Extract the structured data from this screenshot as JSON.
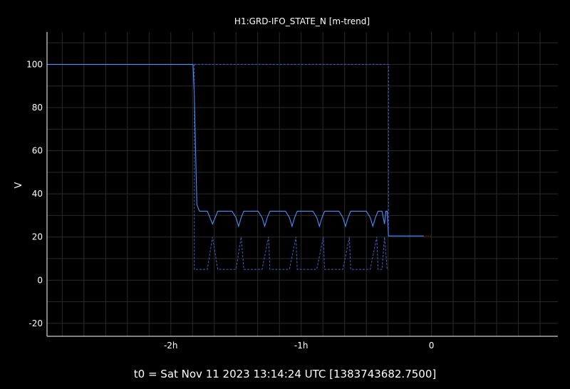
{
  "chart_data": {
    "type": "line",
    "title": "H1:GRD-IFO_STATE_N [m-trend]",
    "ylabel": "V",
    "xlabel": "",
    "footer": "t0 = Sat Nov 11 2023 13:14:24 UTC [1383743682.7500]",
    "x_unit": "hours relative to t0",
    "xlim": [
      -2.95,
      0.97
    ],
    "ylim": [
      -26,
      115
    ],
    "x_ticks": [
      {
        "value": -2,
        "label": "-2h"
      },
      {
        "value": -1,
        "label": "-1h"
      },
      {
        "value": 0,
        "label": "0"
      }
    ],
    "y_ticks": [
      -20,
      0,
      20,
      40,
      60,
      80,
      100
    ],
    "grid": true,
    "colors": {
      "background": "#000000",
      "grid": "#2a2a2a",
      "axis": "#ffffff",
      "mean": "#4a90ff",
      "range": "#3b63c9",
      "trailing": "#c0392b"
    },
    "series": [
      {
        "style": "solid",
        "x": [
          -2.95,
          -1.83,
          -1.82,
          -1.8,
          -1.78,
          -1.77,
          -1.72,
          -1.7,
          -1.68,
          -1.66,
          -1.64,
          -1.57,
          -1.53,
          -1.5,
          -1.48,
          -1.46,
          -1.44,
          -1.36,
          -1.33,
          -1.3,
          -1.28,
          -1.26,
          -1.24,
          -1.15,
          -1.12,
          -1.09,
          -1.07,
          -1.05,
          -1.03,
          -0.94,
          -0.91,
          -0.88,
          -0.86,
          -0.84,
          -0.82,
          -0.74,
          -0.71,
          -0.68,
          -0.66,
          -0.64,
          -0.62,
          -0.53,
          -0.5,
          -0.47,
          -0.45,
          -0.43,
          -0.41,
          -0.38,
          -0.36,
          -0.35,
          -0.34,
          -0.33,
          -0.06
        ],
        "y": [
          100,
          100,
          86,
          35,
          32,
          32,
          32,
          29,
          26,
          29,
          32,
          32,
          32,
          29,
          25,
          29,
          32,
          32,
          32,
          29,
          25,
          29,
          32,
          32,
          32,
          29,
          25,
          29,
          32,
          32,
          32,
          29,
          25,
          29,
          32,
          32,
          32,
          29,
          25,
          29,
          32,
          32,
          32,
          29,
          25,
          29,
          32,
          32,
          26,
          32,
          32,
          20.5,
          20.5
        ]
      },
      {
        "style": "dashed",
        "x": [
          -1.82,
          -1.82,
          -0.33,
          -0.33
        ],
        "y": [
          100,
          100,
          100,
          20.5
        ]
      },
      {
        "style": "dashed",
        "x": [
          -1.82,
          -1.82,
          -1.72,
          -1.68,
          -1.64,
          -1.57,
          -1.5,
          -1.46,
          -1.44,
          -1.36,
          -1.3,
          -1.25,
          -1.24,
          -1.15,
          -1.09,
          -1.04,
          -1.03,
          -0.94,
          -0.88,
          -0.83,
          -0.82,
          -0.74,
          -0.68,
          -0.63,
          -0.62,
          -0.53,
          -0.47,
          -0.42,
          -0.41,
          -0.38,
          -0.36,
          -0.34,
          -0.33
        ],
        "y": [
          100,
          5,
          5,
          20,
          5,
          5,
          5,
          20,
          5,
          5,
          5,
          20,
          5,
          5,
          5,
          20,
          5,
          5,
          5,
          20,
          5,
          5,
          5,
          20,
          5,
          5,
          5,
          20,
          5,
          5,
          20,
          5,
          5
        ]
      },
      {
        "style": "dotted",
        "x": [
          -0.06,
          0.0
        ],
        "y": [
          20.5,
          20.5
        ]
      }
    ]
  }
}
